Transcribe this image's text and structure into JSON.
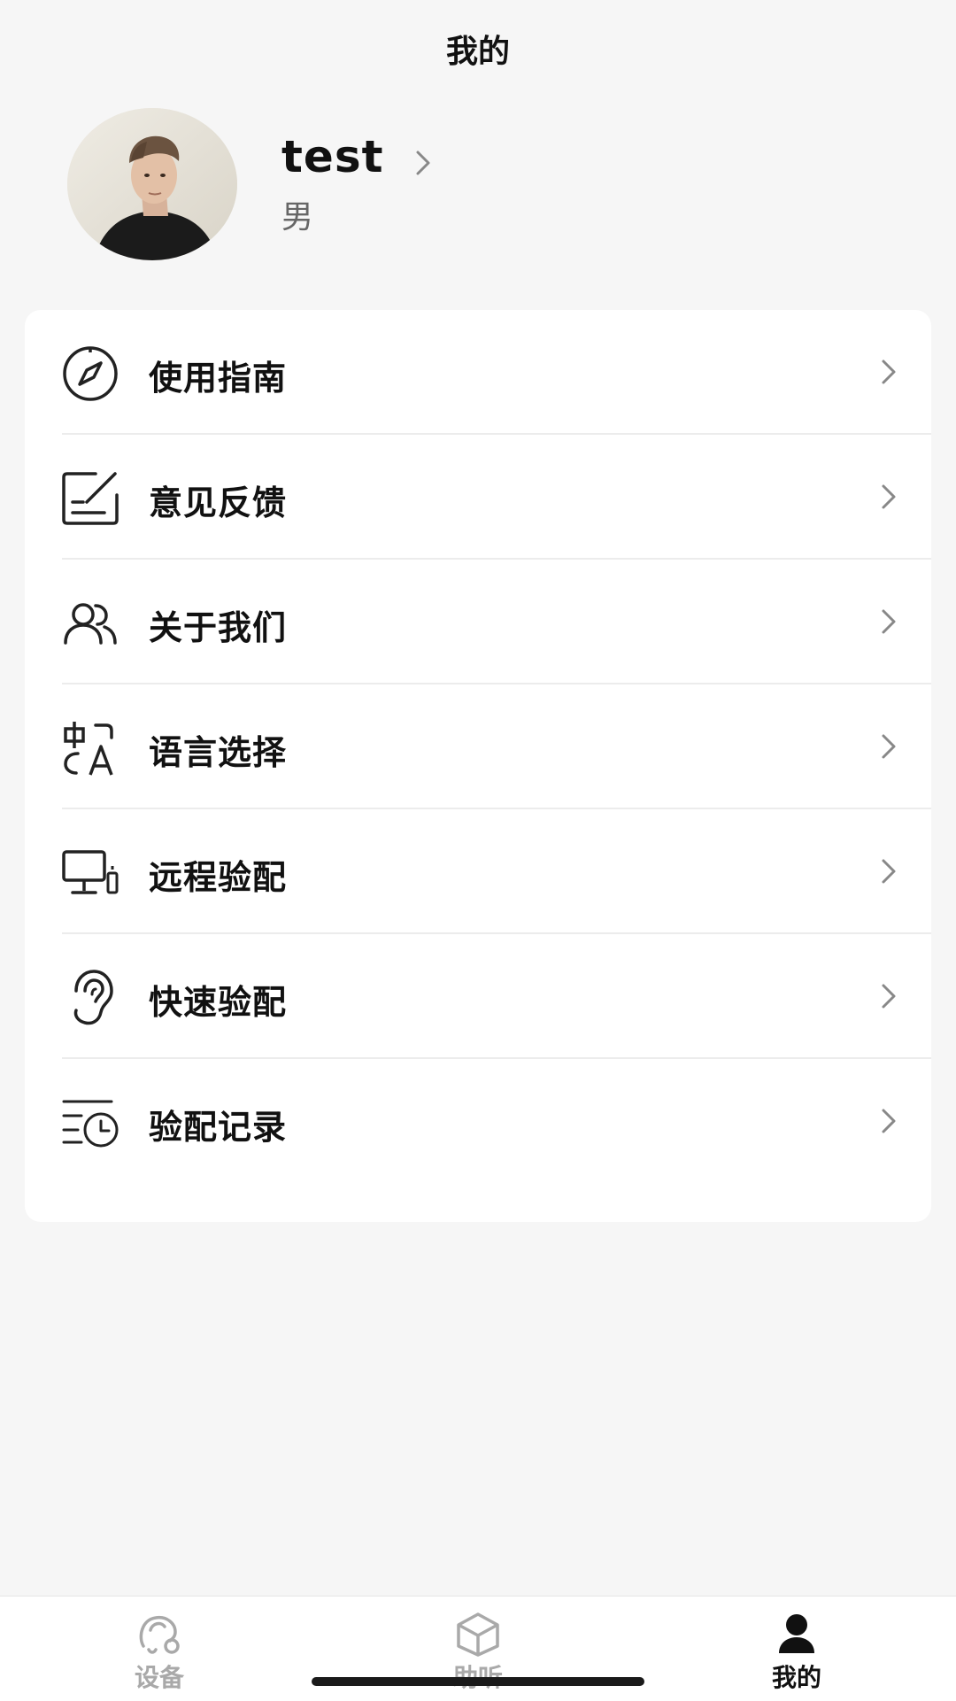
{
  "header": {
    "title": "我的"
  },
  "profile": {
    "name": "test",
    "gender": "男"
  },
  "menu": {
    "items": [
      {
        "label": "使用指南",
        "icon": "compass-icon"
      },
      {
        "label": "意见反馈",
        "icon": "feedback-edit-icon"
      },
      {
        "label": "关于我们",
        "icon": "users-icon"
      },
      {
        "label": "语言选择",
        "icon": "translate-icon"
      },
      {
        "label": "远程验配",
        "icon": "remote-monitor-icon"
      },
      {
        "label": "快速验配",
        "icon": "ear-icon"
      },
      {
        "label": "验配记录",
        "icon": "history-clock-icon"
      }
    ]
  },
  "tabbar": {
    "tabs": [
      {
        "label": "设备",
        "icon": "device-icon",
        "active": false
      },
      {
        "label": "助听",
        "icon": "cube-icon",
        "active": false
      },
      {
        "label": "我的",
        "icon": "person-icon",
        "active": true
      }
    ],
    "active_color": "#111111",
    "inactive_color": "#a9a9a9"
  }
}
